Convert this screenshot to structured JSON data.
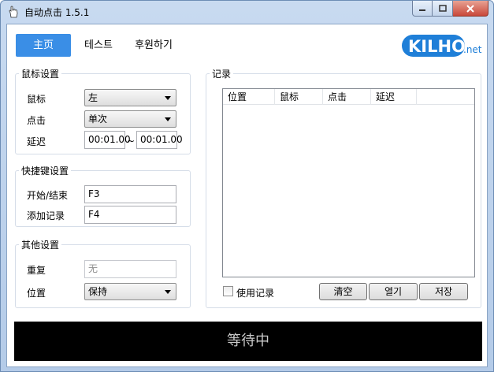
{
  "window": {
    "title": "自动点击 1.5.1"
  },
  "tabs": [
    {
      "label": "主页"
    },
    {
      "label": "테스트"
    },
    {
      "label": "후원하기"
    }
  ],
  "logo": {
    "main": "KILHO",
    "suffix": ".net"
  },
  "mouse_settings": {
    "legend": "鼠标设置",
    "button_label": "鼠标",
    "button_value": "左",
    "click_label": "点击",
    "click_value": "单次",
    "delay_label": "延迟",
    "delay_from": "00:01.00",
    "delay_sep": "~",
    "delay_to": "00:01.00"
  },
  "hotkey_settings": {
    "legend": "快捷键设置",
    "start_stop_label": "开始/结束",
    "start_stop_value": "F3",
    "add_record_label": "添加记录",
    "add_record_value": "F4"
  },
  "other_settings": {
    "legend": "其他设置",
    "repeat_label": "重复",
    "repeat_value": "无",
    "position_label": "位置",
    "position_value": "保持"
  },
  "record": {
    "legend": "记录",
    "columns": [
      "位置",
      "鼠标",
      "点击",
      "延迟"
    ],
    "use_record_label": "使用记录",
    "clear_label": "清空",
    "open_label": "열기",
    "save_label": "저장"
  },
  "status": {
    "text": "等待中"
  },
  "colors": {
    "active_tab": "#3a8ee6",
    "logo": "#1f7fd8",
    "status_bg": "#000000"
  }
}
